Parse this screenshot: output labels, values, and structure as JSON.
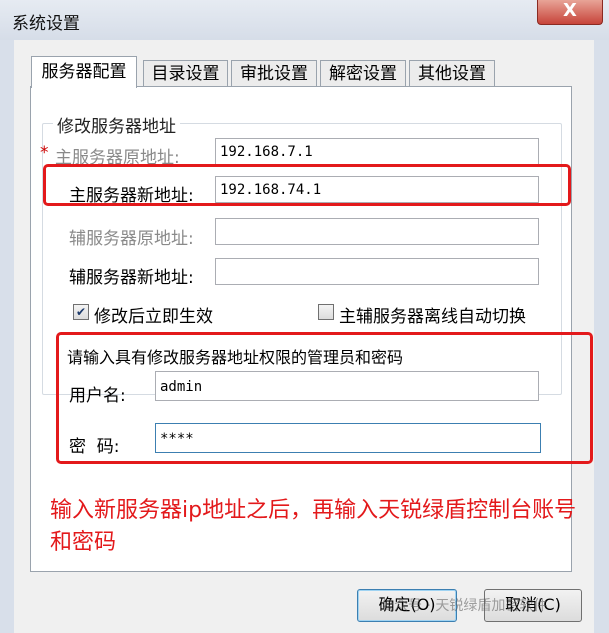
{
  "window": {
    "title": "系统设置",
    "close_glyph": "X"
  },
  "tabs": [
    {
      "label": "服务器配置",
      "active": true
    },
    {
      "label": "目录设置"
    },
    {
      "label": "审批设置"
    },
    {
      "label": "解密设置"
    },
    {
      "label": "其他设置"
    }
  ],
  "server_group": {
    "title": "修改服务器地址",
    "required_mark": "*",
    "primary_old": {
      "label": "主服务器原地址:",
      "value": "192.168.7.1"
    },
    "primary_new": {
      "label": "主服务器新地址:",
      "value": "192.168.74.1"
    },
    "secondary_old": {
      "label": "辅服务器原地址:",
      "value": ""
    },
    "secondary_new": {
      "label": "辅服务器新地址:",
      "value": ""
    },
    "apply_now": {
      "label": "修改后立即生效",
      "checked": true
    },
    "auto_switch": {
      "label": "主辅服务器离线自动切换",
      "checked": false
    }
  },
  "auth": {
    "prompt": "请输入具有修改服务器地址权限的管理员和密码",
    "username_label": "用户名:",
    "username_value": "admin",
    "password_label": "密  码:",
    "password_value": "****"
  },
  "annotation": "输入新服务器ip地址之后，再输入天锐绿盾控制台账号和密码",
  "buttons": {
    "ok": "确定(O)",
    "cancel": "取消(C)"
  },
  "watermark": "公众号 · 天锐绿盾加密软件"
}
